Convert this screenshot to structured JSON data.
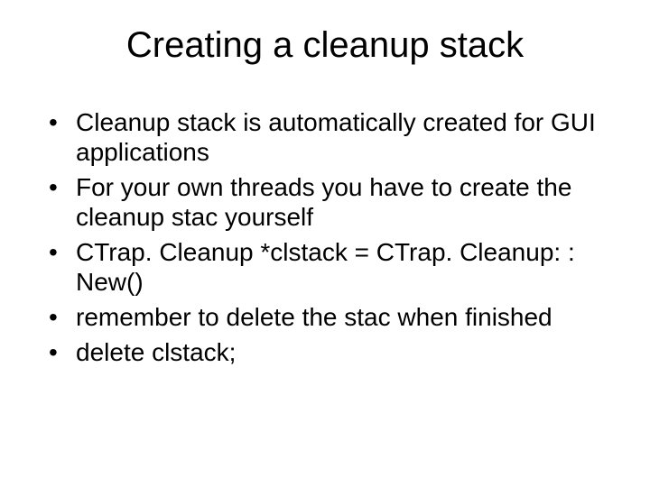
{
  "slide": {
    "title": "Creating a cleanup stack",
    "bullets": [
      "Cleanup stack is automatically created for GUI applications",
      "For your own threads you have to create the cleanup stac yourself",
      "CTrap. Cleanup *clstack = CTrap. Cleanup: : New()",
      "remember to delete the stac when finished",
      "delete clstack;"
    ]
  }
}
